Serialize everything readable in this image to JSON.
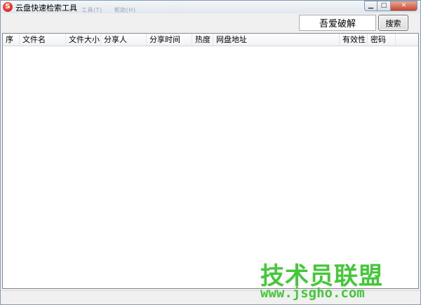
{
  "window": {
    "title": "云盘快速检索工具",
    "ghost_menu": [
      "工具(T)",
      "帮助(H)"
    ]
  },
  "search": {
    "value": "吾爱破解",
    "button_label": "搜索"
  },
  "table": {
    "columns": [
      "序",
      "文件名",
      "文件大小",
      "分享人",
      "分享时间",
      "热度",
      "网盘地址",
      "有效性",
      "密码"
    ],
    "rows": []
  },
  "watermark": {
    "title": "技术员联盟",
    "url": "www.jsgho.com"
  },
  "colors": {
    "watermark_green": "#44c83a",
    "close_button": "#c8452c"
  }
}
